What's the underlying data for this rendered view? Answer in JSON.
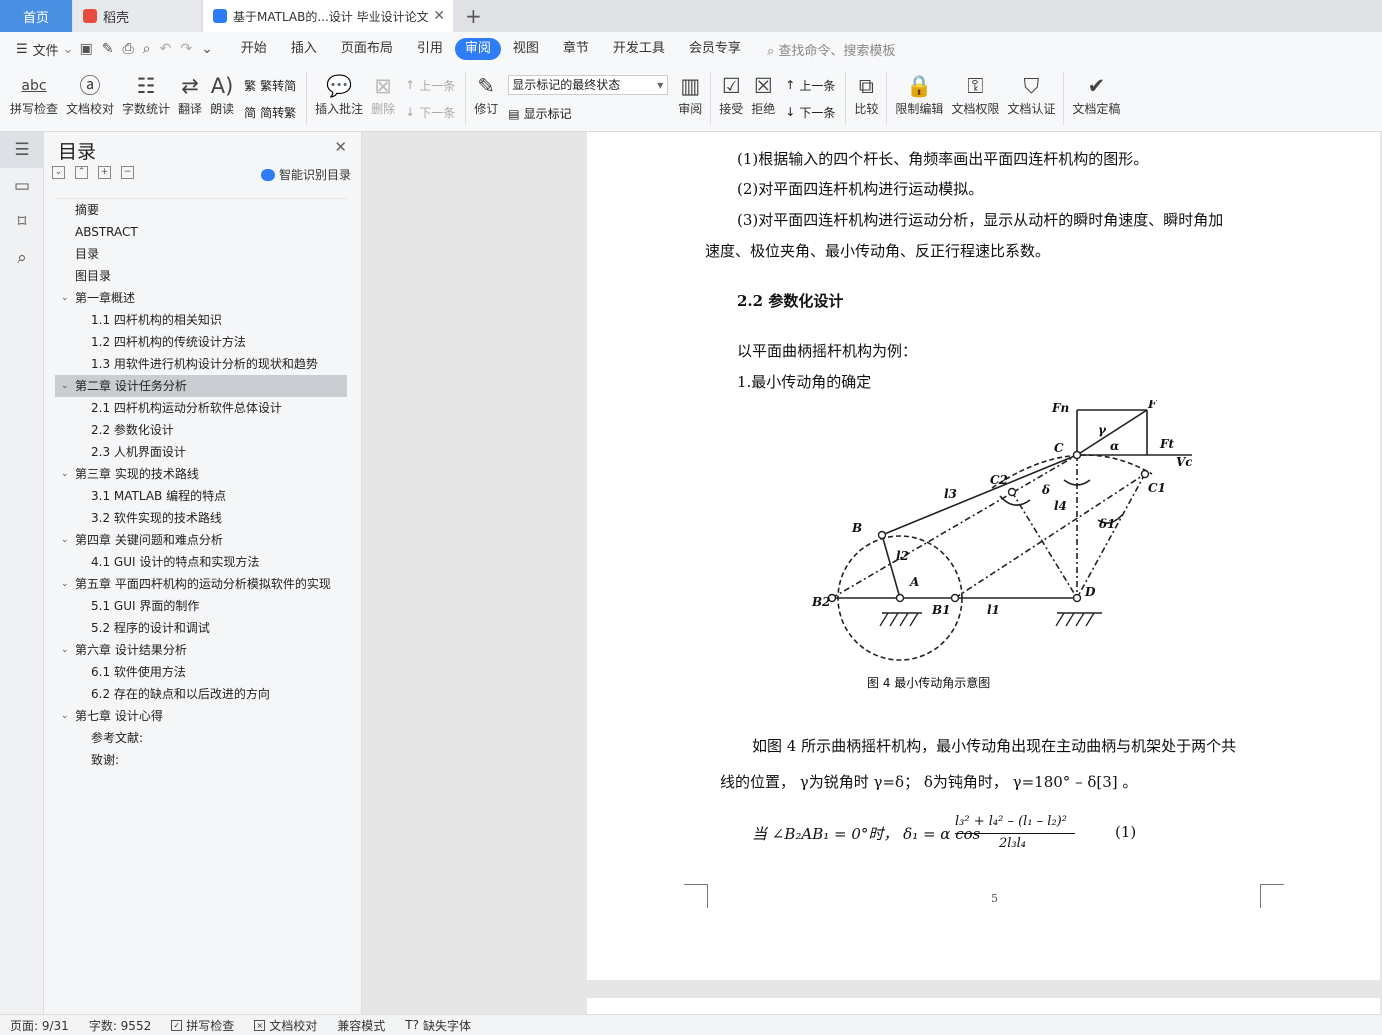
{
  "tabs": {
    "home": "首页",
    "daoke": "稻壳",
    "document": "基于MATLAB的...设计 毕业设计论文",
    "close": "✕",
    "add": "+"
  },
  "menu": {
    "file": "文件",
    "items": [
      "开始",
      "插入",
      "页面布局",
      "引用",
      "审阅",
      "视图",
      "章节",
      "开发工具",
      "会员专享"
    ],
    "active": "审阅",
    "search": "查找命令、搜索模板"
  },
  "toolbar": {
    "spell": "拼写检查",
    "proofread": "文档校对",
    "wordcount": "字数统计",
    "translate": "翻译",
    "read": "朗读",
    "to_traditional": "繁转简",
    "to_simplified": "简转繁",
    "insert_comment": "插入批注",
    "delete": "删除",
    "prev": "上一条",
    "next": "下一条",
    "track": "修订",
    "markup_select": "显示标记的最终状态",
    "show_markup": "显示标记",
    "review": "审阅",
    "accept": "接受",
    "reject": "拒绝",
    "prev2": "上一条",
    "next2": "下一条",
    "compare": "比较",
    "restrict": "限制编辑",
    "permission": "文档权限",
    "certify": "文档认证",
    "finalize": "文档定稿",
    "abc": "abc"
  },
  "toc": {
    "title": "目录",
    "ai_label": "智能识别目录",
    "items": [
      {
        "text": "摘要",
        "level": 1,
        "chev": ""
      },
      {
        "text": "ABSTRACT",
        "level": 1,
        "chev": ""
      },
      {
        "text": "目录",
        "level": 1,
        "chev": ""
      },
      {
        "text": "图目录",
        "level": 1,
        "chev": ""
      },
      {
        "text": "第一章概述",
        "level": 0,
        "chev": "⌄"
      },
      {
        "text": "1.1  四杆机构的相关知识",
        "level": 2,
        "chev": ""
      },
      {
        "text": "1.2  四杆机构的传统设计方法",
        "level": 2,
        "chev": ""
      },
      {
        "text": "1.3  用软件进行机构设计分析的现状和趋势",
        "level": 2,
        "chev": ""
      },
      {
        "text": "第二章  设计任务分析",
        "level": 0,
        "chev": "⌄"
      },
      {
        "text": "2.1  四杆机构运动分析软件总体设计",
        "level": 2,
        "chev": ""
      },
      {
        "text": "2.2  参数化设计",
        "level": 2,
        "chev": ""
      },
      {
        "text": "2.3  人机界面设计",
        "level": 2,
        "chev": ""
      },
      {
        "text": "第三章  实现的技术路线",
        "level": 0,
        "chev": "⌄"
      },
      {
        "text": "3.1 MATLAB 编程的特点",
        "level": 2,
        "chev": ""
      },
      {
        "text": "3.2  软件实现的技术路线",
        "level": 2,
        "chev": ""
      },
      {
        "text": "第四章  关键问题和难点分析",
        "level": 0,
        "chev": "⌄"
      },
      {
        "text": "4.1 GUI 设计的特点和实现方法",
        "level": 2,
        "chev": ""
      },
      {
        "text": "第五章  平面四杆机构的运动分析模拟软件的实现",
        "level": 0,
        "chev": "⌄"
      },
      {
        "text": "5.1 GUI 界面的制作",
        "level": 2,
        "chev": ""
      },
      {
        "text": "5.2 程序的设计和调试",
        "level": 2,
        "chev": ""
      },
      {
        "text": "第六章  设计结果分析",
        "level": 0,
        "chev": "⌄"
      },
      {
        "text": "6.1 软件使用方法",
        "level": 2,
        "chev": ""
      },
      {
        "text": "6.2 存在的缺点和以后改进的方向",
        "level": 2,
        "chev": ""
      },
      {
        "text": "第七章  设计心得",
        "level": 0,
        "chev": "⌄"
      },
      {
        "text": "参考文献:",
        "level": 2,
        "chev": ""
      },
      {
        "text": "致谢:",
        "level": 2,
        "chev": ""
      }
    ],
    "selected_index": 8
  },
  "doc": {
    "p1": "(1)根据输入的四个杆长、角频率画出平面四连杆机构的图形。",
    "p2": "(2)对平面四连杆机构进行运动模拟。",
    "p3a": "(3)对平面四连杆机构进行运动分析，显示从动杆的瞬时角速度、瞬时角加",
    "p3b": "速度、极位夹角、最小传动角、反正行程速比系数。",
    "h": "2.2  参数化设计",
    "p4": "以平面曲柄摇杆机构为例：",
    "p5": "1.最小传动角的确定",
    "caption": "图 4 最小传动角示意图",
    "p6a": "如图 4 所示曲柄摇杆机构，最小传动角出现在主动曲柄与机架处于两个共",
    "p6b": "线的位置，  γ为锐角时   γ=δ；  δ为钝角时，  γ=180° – δ[3] 。",
    "formula_left": "当 ∠B₂AB₁ = 0°时，   δ₁ = α cos",
    "num": "l₃² + l₄² – (l₁ – l₂)²",
    "den": "2l₃l₄",
    "eqno": "(1)",
    "page_no": "5",
    "fig_labels": [
      "Fn",
      "F",
      "γ",
      "α",
      "C",
      "Ft",
      "Vc",
      "C2",
      "C1",
      "l3",
      "δ",
      "l4",
      "δ1",
      "B",
      "l2",
      "A",
      "B2",
      "B1",
      "l1",
      "D"
    ]
  },
  "status": {
    "page": "页面: 9/31",
    "words": "字数: 9552",
    "spell": "拼写检查",
    "proof": "文档校对",
    "compat": "兼容模式",
    "missing_font": "缺失字体"
  }
}
